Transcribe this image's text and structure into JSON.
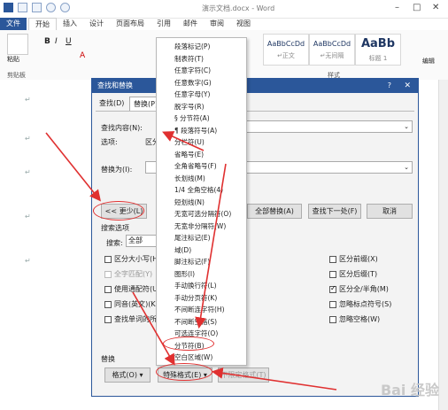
{
  "app": {
    "title": "演示文档.docx - Word"
  },
  "ribbon": {
    "tabs": [
      "文件",
      "开始",
      "插入",
      "设计",
      "页面布局",
      "引用",
      "邮件",
      "审阅",
      "视图"
    ],
    "clipboard_label": "剪贴板",
    "paste_label": "粘贴",
    "styles_label": "样式",
    "edit_label": "编辑",
    "styles": [
      {
        "sample": "AaBbCcDd",
        "name": "↵正文"
      },
      {
        "sample": "AaBbCcDd",
        "name": "↵无间隔"
      },
      {
        "sample": "AaBb",
        "name": "标题 1"
      }
    ]
  },
  "dialog": {
    "title": "查找和替换",
    "help": "?",
    "tabs": [
      "查找(D)",
      "替换(P)"
    ],
    "find_label": "查找内容(N):",
    "find_value": "^b",
    "options_label": "选项:",
    "options_value": "区分",
    "replace_label": "替换为(I):",
    "less_button": "<< 更少(L)",
    "replace_all_button": "全部替换(A)",
    "find_next_button": "查找下一处(F)",
    "cancel_button": "取消",
    "search_options_label": "搜索选项",
    "search_label": "搜索:",
    "search_value": "全部",
    "left_checks": [
      {
        "label": "区分大小写(H",
        "checked": false,
        "disabled": false
      },
      {
        "label": "全字匹配(Y)",
        "checked": false,
        "disabled": true
      },
      {
        "label": "使用通配符(U",
        "checked": false,
        "disabled": false
      },
      {
        "label": "同音(英文)(K)",
        "checked": false,
        "disabled": false
      },
      {
        "label": "查找单词的所",
        "checked": false,
        "disabled": false
      }
    ],
    "right_checks": [
      {
        "label": "区分前缀(X)",
        "checked": false
      },
      {
        "label": "区分后缀(T)",
        "checked": false
      },
      {
        "label": "区分全/半角(M)",
        "checked": true
      },
      {
        "label": "忽略标点符号(S)",
        "checked": false
      },
      {
        "label": "忽略空格(W)",
        "checked": false
      }
    ],
    "replace_section_label": "替换",
    "format_button": "格式(O) ▾",
    "special_button": "特殊格式(E) ▾",
    "no_format_button": "不限定格式(T)"
  },
  "menu": {
    "items": [
      "段落标记(P)",
      "制表符(T)",
      "任意字符(C)",
      "任意数字(G)",
      "任意字母(Y)",
      "脱字号(R)",
      "§ 分节符(A)",
      "¶ 段落符号(A)",
      "分栏符(U)",
      "省略号(E)",
      "全角省略号(F)",
      "长划线(M)",
      "1/4 全角空格(4)",
      "短划线(N)",
      "无宽可选分隔符(O)",
      "无宽非分隔符(W)",
      "尾注标记(E)",
      "域(D)",
      "脚注标记(F)",
      "图形(I)",
      "手动换行符(L)",
      "手动分页符(K)",
      "不间断连字符(H)",
      "不间断空格(S)",
      "可选连字符(O)",
      "分节符(B)",
      "空白区域(W)"
    ],
    "highlighted": "分节符(B)"
  },
  "watermark": "Bai 经验"
}
